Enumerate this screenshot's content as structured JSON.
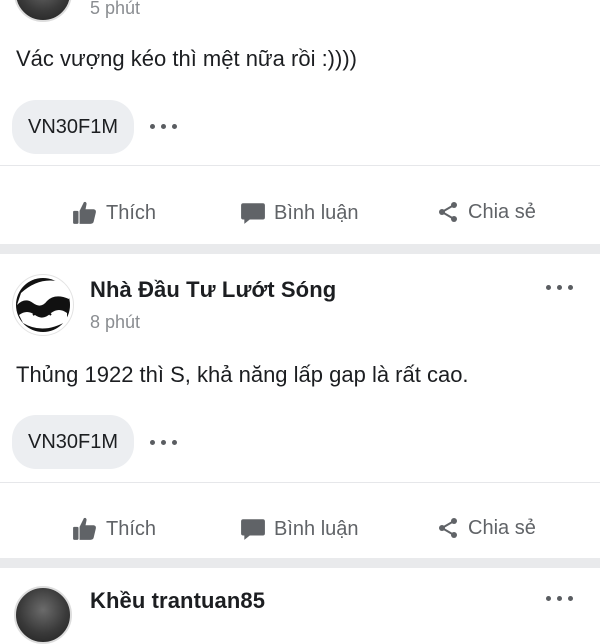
{
  "post1": {
    "time": "5 phút",
    "text": "Vác vượng kéo thì mệt nữa rồi :))))",
    "tag": "VN30F1M"
  },
  "post2": {
    "author": "Nhà Đầu Tư Lướt Sóng",
    "time": "8 phút",
    "text": "Thủng 1922 thì S, khả năng lấp gap là rất cao.",
    "tag": "VN30F1M"
  },
  "post3": {
    "author_partial": "Khều trantuan85"
  },
  "actions": {
    "like": "Thích",
    "comment": "Bình luận",
    "share": "Chia sẻ"
  },
  "icons": {
    "like": "thumbs-up-icon",
    "comment": "comment-icon",
    "share": "share-icon",
    "more": "more-horizontal-icon"
  },
  "colors": {
    "text": "#1c1e21",
    "muted": "#8a8d91",
    "action": "#606367",
    "chip_bg": "#eceef1",
    "separator": "#e9eaec"
  }
}
